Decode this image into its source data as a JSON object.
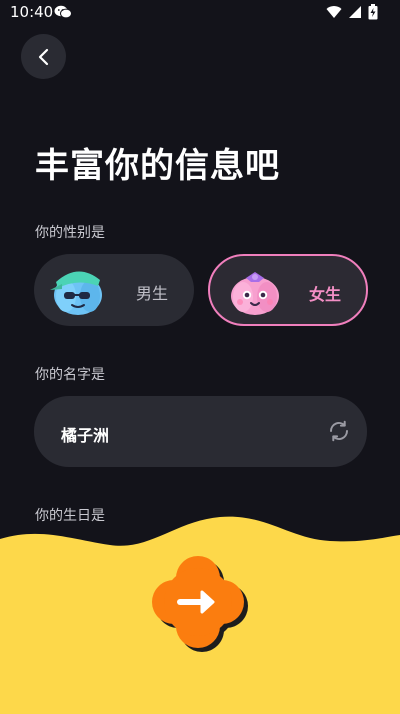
{
  "status_bar": {
    "time": "10:40",
    "icons": [
      "wechat-icon",
      "wifi-icon",
      "signal-icon",
      "battery-icon"
    ]
  },
  "header": {
    "back_icon": "chevron-left-icon",
    "title": "丰富你的信息吧"
  },
  "gender": {
    "label": "你的性别是",
    "options": [
      {
        "label": "男生",
        "selected": false,
        "avatar": "boy-avatar-icon"
      },
      {
        "label": "女生",
        "selected": true,
        "avatar": "girl-avatar-icon"
      }
    ]
  },
  "name": {
    "label": "你的名字是",
    "value": "橘子洲",
    "refresh_icon": "refresh-icon"
  },
  "birthday": {
    "label": "你的生日是"
  },
  "footer": {
    "next_icon": "arrow-right-icon"
  },
  "colors": {
    "background": "#13131a",
    "card": "#2a2b33",
    "accent_pink": "#f07fbd",
    "footer_yellow": "#fdd84a",
    "button_orange": "#fb7d0f"
  }
}
